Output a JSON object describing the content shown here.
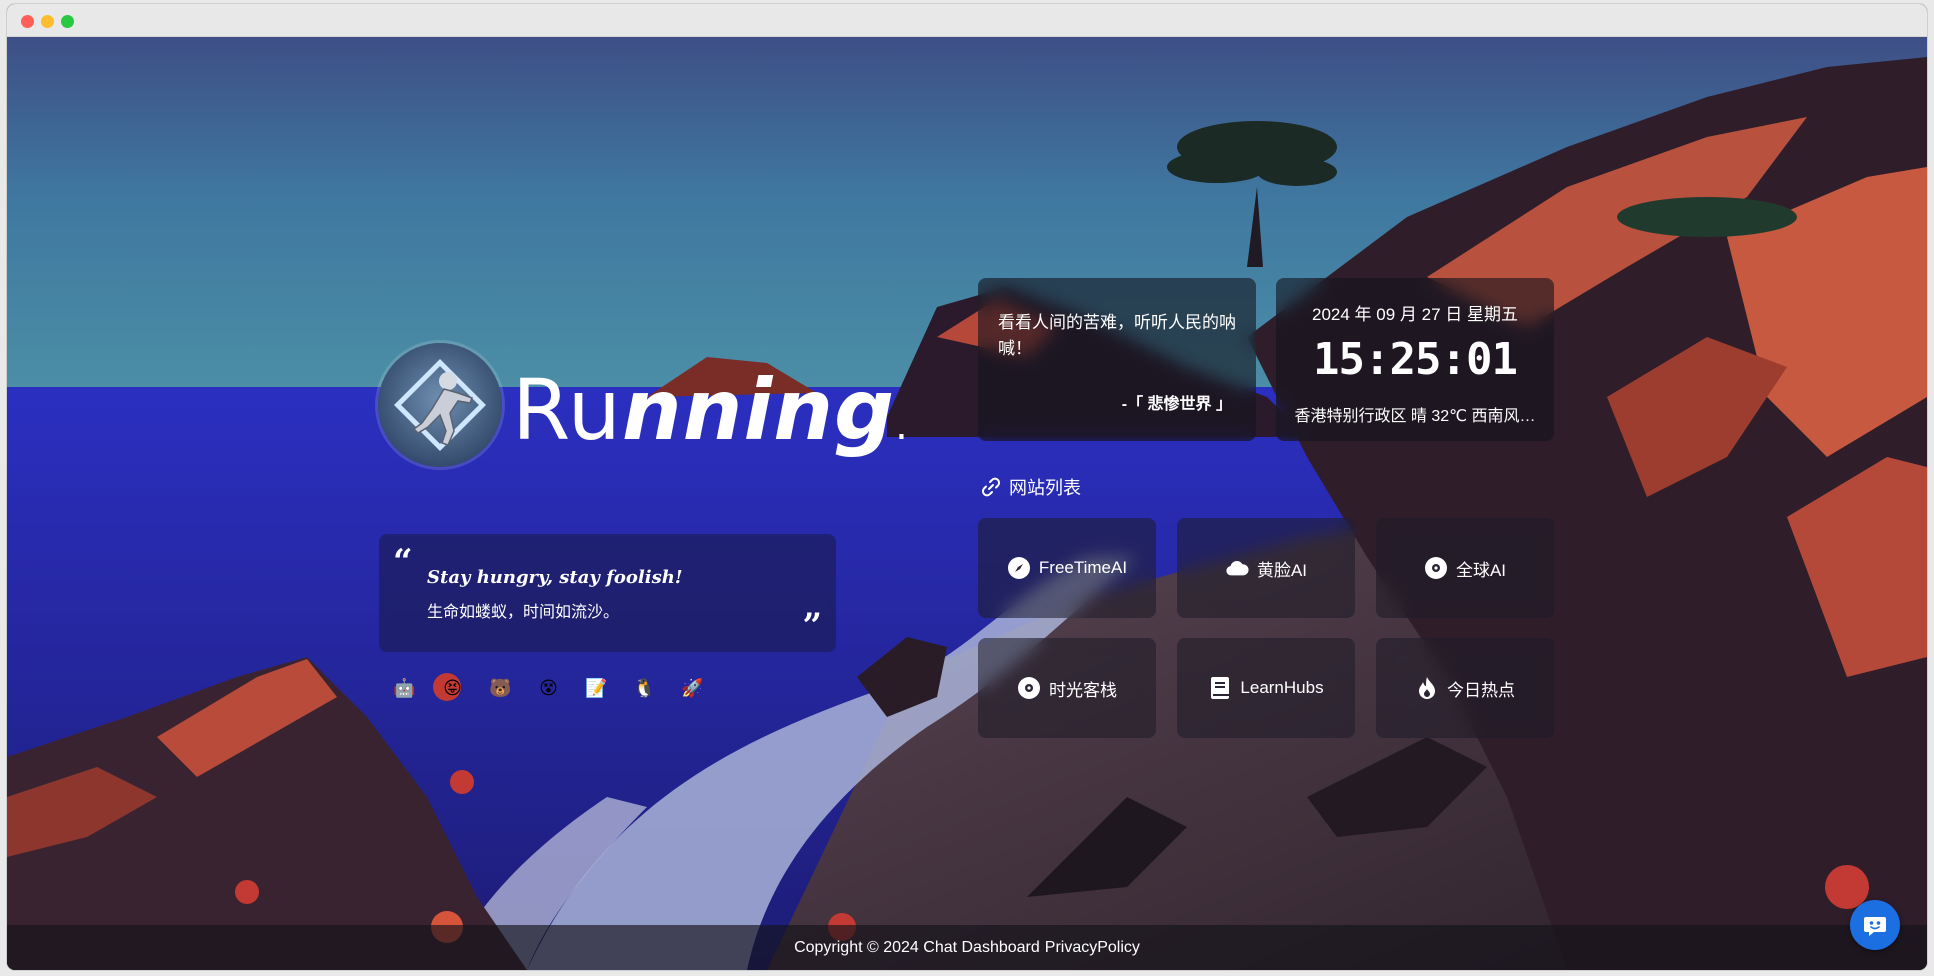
{
  "brand": {
    "name_upright": "Ru",
    "name_italic": "nning",
    "name_end": "g",
    "dot": "."
  },
  "quote": {
    "open": "“",
    "close": "”",
    "en": "Stay hungry, stay foolish!",
    "cn": "生命如蝼蚁，时间如流沙。"
  },
  "socials": [
    {
      "icon": "robot-icon"
    },
    {
      "icon": "tongue-face-icon"
    },
    {
      "icon": "bear-icon"
    },
    {
      "icon": "dizzy-face-icon"
    },
    {
      "icon": "memo-icon"
    },
    {
      "icon": "penguin-icon"
    },
    {
      "icon": "rocket-icon"
    }
  ],
  "poem": {
    "text": "看看人间的苦难，听听人民的呐喊！",
    "source": "-「 悲惨世界 」"
  },
  "time": {
    "date": "2024 年 09 月 27 日 星期五",
    "clock": "15:25:01",
    "weather": "香港特别行政区 晴 32℃ 西南风…"
  },
  "sites": {
    "heading": "网站列表",
    "heading_icon": "link-icon",
    "items": [
      {
        "label": "FreeTimeAI",
        "icon": "compass-icon"
      },
      {
        "label": "黄脸AI",
        "icon": "cloud-icon"
      },
      {
        "label": "全球AI",
        "icon": "disc-icon"
      },
      {
        "label": "时光客栈",
        "icon": "disc-icon"
      },
      {
        "label": "LearnHubs",
        "icon": "book-icon"
      },
      {
        "label": "今日热点",
        "icon": "fire-icon"
      }
    ]
  },
  "footer": {
    "copyright": "Copyright © 2024 Chat Dashboard",
    "policy": "PrivacyPolicy"
  },
  "colors": {
    "accent_chat": "#1b6fe0"
  }
}
